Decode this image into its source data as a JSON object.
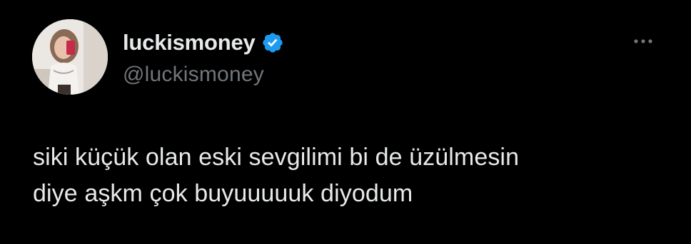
{
  "tweet": {
    "display_name": "luckismoney",
    "handle": "@luckismoney",
    "verified_icon": "verified-badge-icon",
    "more_icon": "more-options-icon",
    "text_lines": [
      "siki küçük olan eski sevgilimi bi de üzülmesin",
      "diye aşkm çok buyuuuuuk diyodum"
    ]
  },
  "colors": {
    "background": "#000000",
    "primary_text": "#e7e9ea",
    "secondary_text": "#71767b",
    "verified_blue": "#1d9bf0"
  }
}
